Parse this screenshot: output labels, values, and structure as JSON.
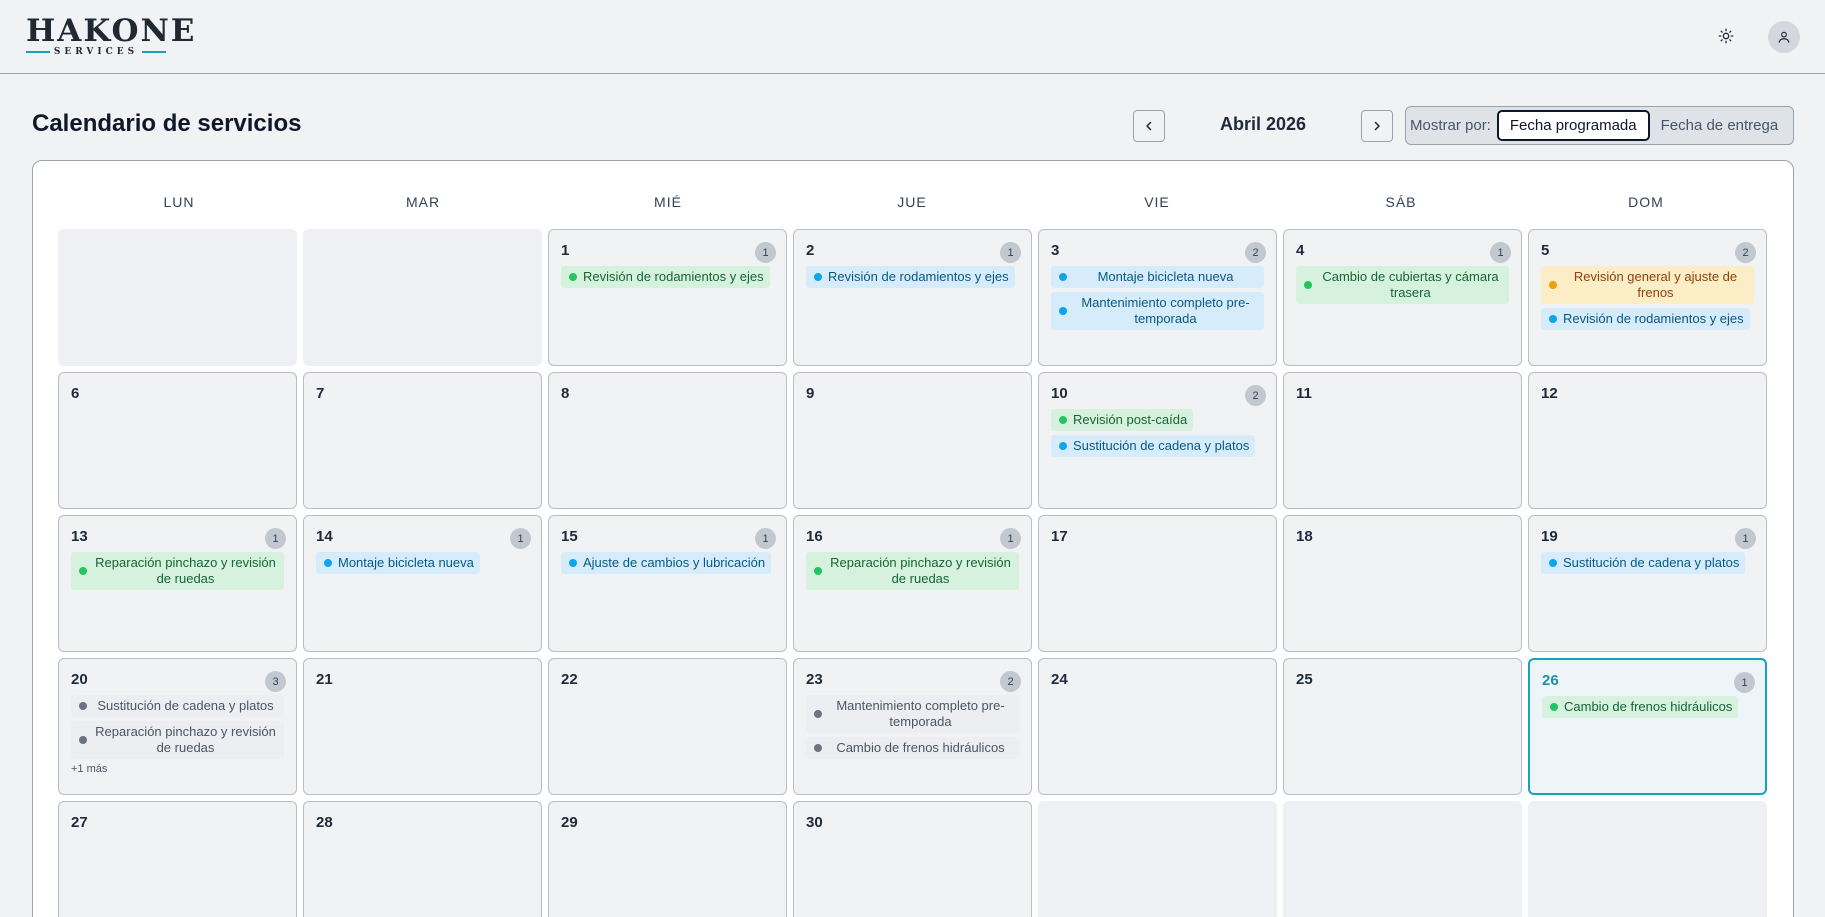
{
  "app": {
    "logo_main": "HAKONE",
    "logo_sub": "SERVICES"
  },
  "page": {
    "title": "Calendario de servicios",
    "month": "Abril 2026",
    "show_by_label": "Mostrar por:",
    "options": [
      "Fecha programada",
      "Fecha de entrega"
    ],
    "selected_option": "Fecha programada"
  },
  "icons": {
    "theme": "sun-icon",
    "user": "user-icon",
    "prev": "chevron-left-icon",
    "next": "chevron-right-icon"
  },
  "colors": {
    "accent": "#17a2b8",
    "event_green": "#22c55e",
    "event_blue": "#0ea5e9",
    "event_amber": "#f59e0b",
    "event_gray": "#6b7280"
  },
  "calendar": {
    "weekdays": [
      "LUN",
      "MAR",
      "MIÉ",
      "JUE",
      "VIE",
      "SÁB",
      "DOM"
    ],
    "today": "26",
    "days": {
      "1": {
        "label": "1",
        "count": "1",
        "events": [
          {
            "title": "Revisión de rodamientos y ejes",
            "status": "green"
          }
        ]
      },
      "2": {
        "label": "2",
        "count": "1",
        "events": [
          {
            "title": "Revisión de rodamientos y ejes",
            "status": "blue"
          }
        ]
      },
      "3": {
        "label": "3",
        "count": "2",
        "events": [
          {
            "title": "Montaje bicicleta nueva",
            "status": "blue"
          },
          {
            "title": "Mantenimiento completo pre-temporada",
            "status": "blue"
          }
        ]
      },
      "4": {
        "label": "4",
        "count": "1",
        "events": [
          {
            "title": "Cambio de cubiertas y cámara trasera",
            "status": "green"
          }
        ]
      },
      "5": {
        "label": "5",
        "count": "2",
        "events": [
          {
            "title": "Revisión general y ajuste de frenos",
            "status": "amber"
          },
          {
            "title": "Revisión de rodamientos y ejes",
            "status": "blue"
          }
        ]
      },
      "6": {
        "label": "6"
      },
      "7": {
        "label": "7"
      },
      "8": {
        "label": "8"
      },
      "9": {
        "label": "9"
      },
      "10": {
        "label": "10",
        "count": "2",
        "events": [
          {
            "title": "Revisión post-caída",
            "status": "green"
          },
          {
            "title": "Sustitución de cadena y platos",
            "status": "blue"
          }
        ]
      },
      "11": {
        "label": "11"
      },
      "12": {
        "label": "12"
      },
      "13": {
        "label": "13",
        "count": "1",
        "events": [
          {
            "title": "Reparación pinchazo y revisión de ruedas",
            "status": "green"
          }
        ]
      },
      "14": {
        "label": "14",
        "count": "1",
        "events": [
          {
            "title": "Montaje bicicleta nueva",
            "status": "blue"
          }
        ]
      },
      "15": {
        "label": "15",
        "count": "1",
        "events": [
          {
            "title": "Ajuste de cambios y lubricación",
            "status": "blue"
          }
        ]
      },
      "16": {
        "label": "16",
        "count": "1",
        "events": [
          {
            "title": "Reparación pinchazo y revisión de ruedas",
            "status": "green"
          }
        ]
      },
      "17": {
        "label": "17"
      },
      "18": {
        "label": "18"
      },
      "19": {
        "label": "19",
        "count": "1",
        "events": [
          {
            "title": "Sustitución de cadena y platos",
            "status": "blue"
          }
        ]
      },
      "20": {
        "label": "20",
        "count": "3",
        "events": [
          {
            "title": "Sustitución de cadena y platos",
            "status": "gray"
          },
          {
            "title": "Reparación pinchazo y revisión de ruedas",
            "status": "gray"
          }
        ],
        "more": "+1 más"
      },
      "21": {
        "label": "21"
      },
      "22": {
        "label": "22"
      },
      "23": {
        "label": "23",
        "count": "2",
        "events": [
          {
            "title": "Mantenimiento completo pre-temporada",
            "status": "gray"
          },
          {
            "title": "Cambio de frenos hidráulicos",
            "status": "gray"
          }
        ]
      },
      "24": {
        "label": "24"
      },
      "25": {
        "label": "25"
      },
      "26": {
        "label": "26",
        "count": "1",
        "events": [
          {
            "title": "Cambio de frenos hidráulicos",
            "status": "green"
          }
        ]
      },
      "27": {
        "label": "27"
      },
      "28": {
        "label": "28"
      },
      "29": {
        "label": "29"
      },
      "30": {
        "label": "30"
      }
    }
  }
}
